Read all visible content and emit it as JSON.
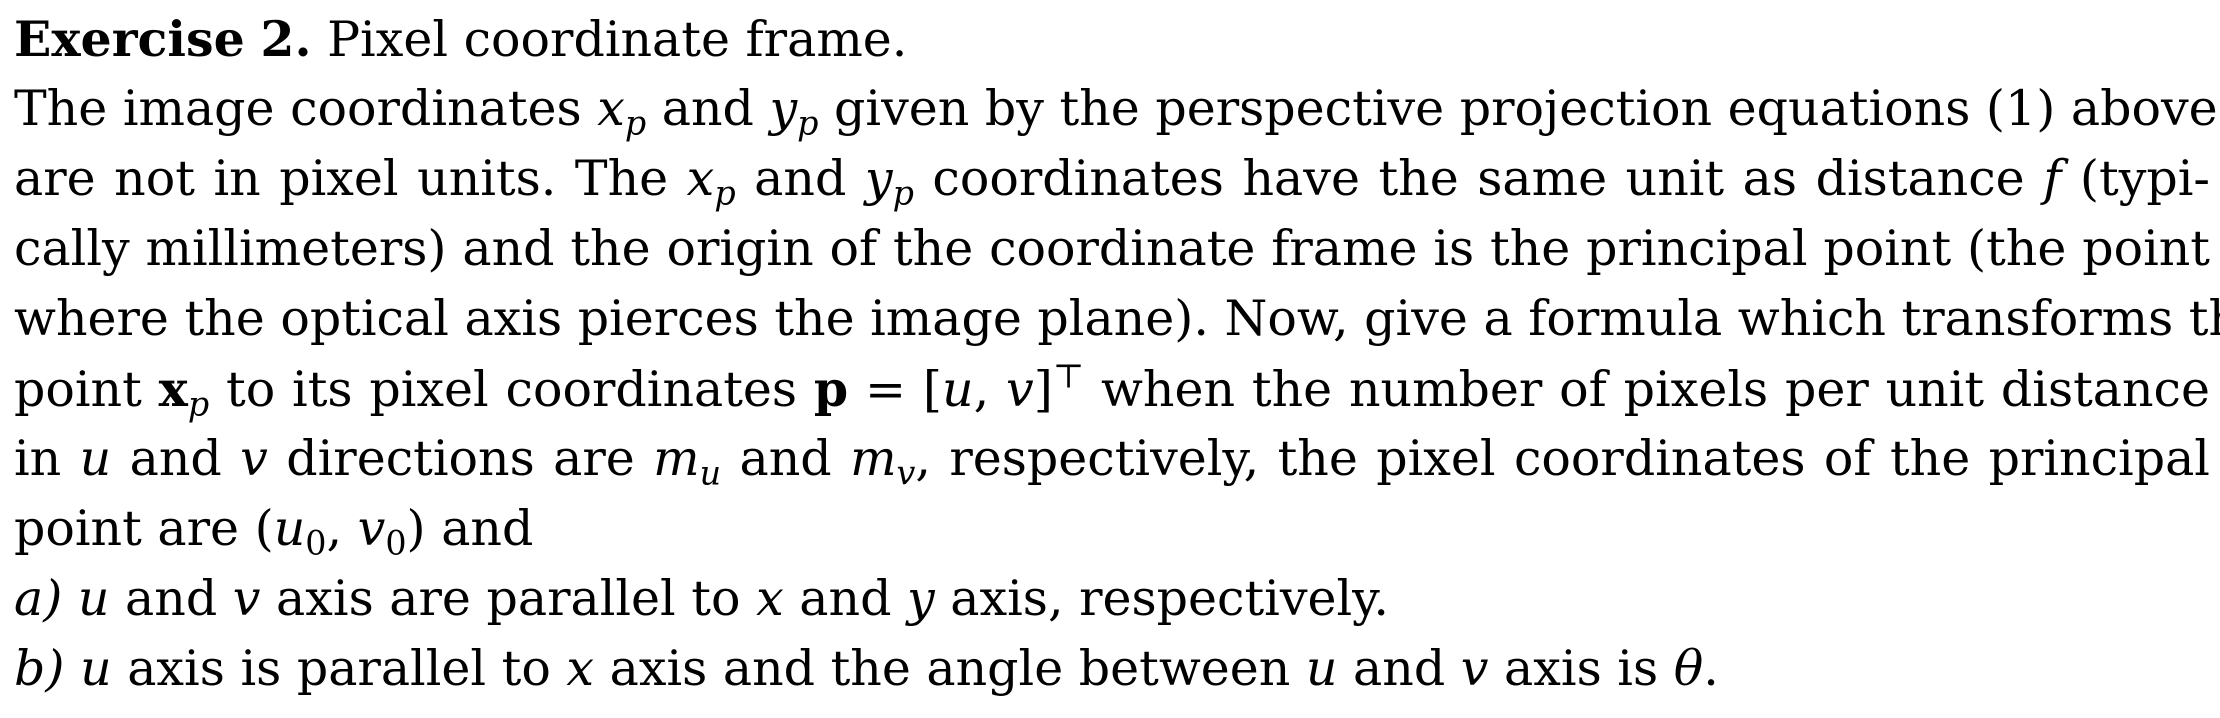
{
  "exercise": {
    "label": "Exercise",
    "number": "2.",
    "title": "Pixel coordinate frame."
  },
  "paragraph": {
    "l1_a": "The image coordinates ",
    "l1_b": " and ",
    "l1_c": " given by the perspective projection equations (1) above",
    "l2_a": "are not in pixel units. The ",
    "l2_b": " and ",
    "l2_c": " coordinates have the same unit as distance ",
    "l2_d": " (typi-",
    "l3": "cally millimeters) and the origin of the coordinate frame is the principal point (the point",
    "l4": "where the optical axis pierces the image plane). Now, give a formula which transforms the",
    "l5_a": "point ",
    "l5_b": " to its pixel coordinates ",
    "l5_c": " when the number of pixels per unit distance",
    "l6_a": "in ",
    "l6_b": " and ",
    "l6_c": " directions are ",
    "l6_d": " and ",
    "l6_e": ", respectively, the pixel coordinates of the principal",
    "l7_a": "point are ",
    "l7_b": " and"
  },
  "math": {
    "x": "x",
    "y": "y",
    "p": "p",
    "f": "f",
    "bold_x": "x",
    "bold_p": "p",
    "eq": " = [",
    "u": "u",
    "v": "v",
    "comma": ", ",
    "close_bracket": "]",
    "transpose": "⊤",
    "m": "m",
    "open_paren": "(",
    "close_paren": ")",
    "zero": "0",
    "theta": "θ"
  },
  "items": [
    {
      "label": "a)",
      "t1": " and ",
      "t2": " axis are parallel to ",
      "t3": " and ",
      "t4": " axis, respectively."
    },
    {
      "label": "b)",
      "t1": " axis is parallel to ",
      "t2": " axis and the angle between ",
      "t3": " and ",
      "t4": " axis is ",
      "t5": "."
    }
  ]
}
